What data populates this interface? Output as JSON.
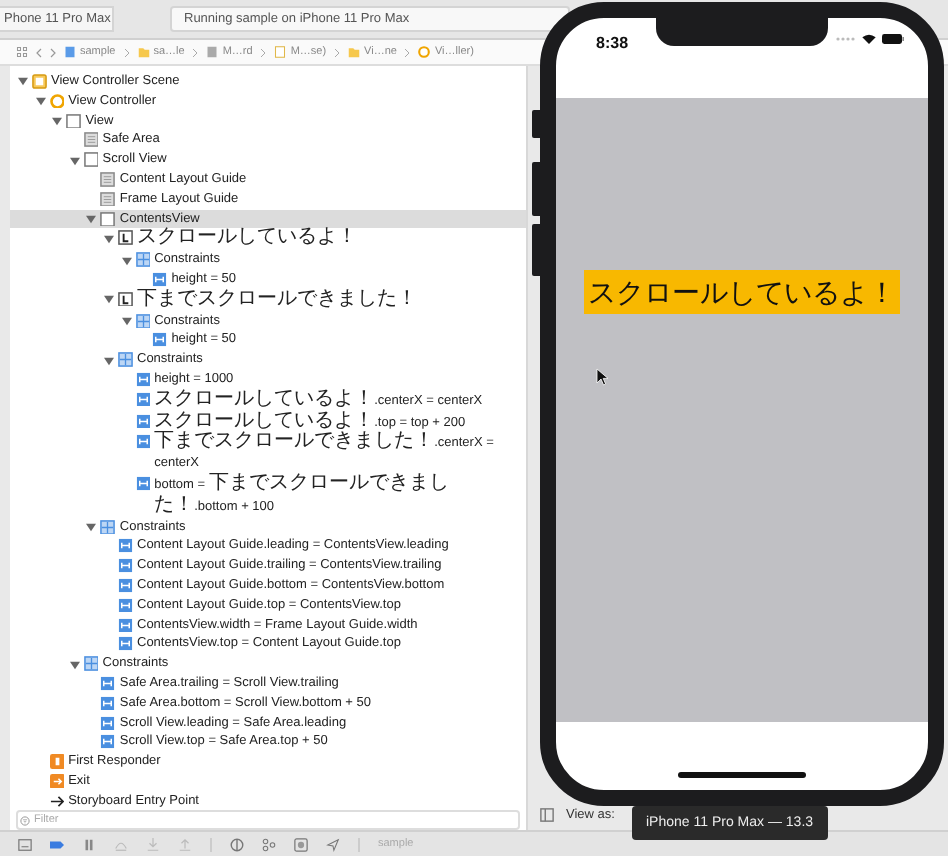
{
  "toolbar": {
    "device": "Phone 11 Pro Max",
    "status": "Running sample on iPhone 11 Pro Max"
  },
  "jump_bar": {
    "crumbs": [
      {
        "kind": "project",
        "label": "sample"
      },
      {
        "kind": "folder",
        "label": "sa…le"
      },
      {
        "kind": "storyboard",
        "label": "M…rd"
      },
      {
        "kind": "file",
        "label": "M…se)"
      },
      {
        "kind": "folder",
        "label": "Vi…ne"
      },
      {
        "kind": "controller",
        "label": "Vi…ller)"
      }
    ]
  },
  "outline": {
    "items": [
      {
        "kind": "scene",
        "label": "View Controller Scene",
        "expanded": true,
        "selected": false,
        "children": [
          {
            "kind": "controller",
            "label": "View Controller",
            "expanded": true,
            "selected": false,
            "children": [
              {
                "kind": "view",
                "label": "View",
                "expanded": true,
                "selected": false,
                "children": [
                  {
                    "kind": "guide",
                    "label": "Safe Area",
                    "selected": false
                  },
                  {
                    "kind": "view",
                    "label": "Scroll View",
                    "expanded": true,
                    "selected": false,
                    "children": [
                      {
                        "kind": "guide",
                        "label": "Content Layout Guide",
                        "selected": false
                      },
                      {
                        "kind": "guide",
                        "label": "Frame Layout Guide",
                        "selected": false
                      },
                      {
                        "kind": "view",
                        "label": "ContentsView",
                        "expanded": true,
                        "selected": true,
                        "children": [
                          {
                            "kind": "label",
                            "label": "スクロールしているよ！",
                            "expanded": true,
                            "selected": false,
                            "children": [
                              {
                                "kind": "constraints",
                                "label": "Constraints",
                                "expanded": true,
                                "selected": false,
                                "children": [
                                  {
                                    "kind": "constraint",
                                    "label": "height = 50",
                                    "selected": false
                                  }
                                ]
                              }
                            ]
                          },
                          {
                            "kind": "label",
                            "label": "下までスクロールできました！",
                            "expanded": true,
                            "selected": false,
                            "children": [
                              {
                                "kind": "constraints",
                                "label": "Constraints",
                                "expanded": true,
                                "selected": false,
                                "children": [
                                  {
                                    "kind": "constraint",
                                    "label": "height = 50",
                                    "selected": false
                                  }
                                ]
                              }
                            ]
                          },
                          {
                            "kind": "constraints",
                            "label": "Constraints",
                            "expanded": true,
                            "selected": false,
                            "children": [
                              {
                                "kind": "constraint",
                                "label": "height = 1000",
                                "selected": false
                              },
                              {
                                "kind": "constraint",
                                "label": "スクロールしているよ！.centerX = centerX",
                                "selected": false
                              },
                              {
                                "kind": "constraint",
                                "label": "スクロールしているよ！.top = top + 200",
                                "selected": false
                              },
                              {
                                "kind": "constraint",
                                "label": "下までスクロールできました！.centerX = centerX",
                                "selected": false
                              },
                              {
                                "kind": "constraint",
                                "label": "bottom = 下までスクロールできました！.bottom + 100",
                                "selected": false
                              }
                            ]
                          }
                        ]
                      },
                      {
                        "kind": "constraints",
                        "label": "Constraints",
                        "expanded": true,
                        "selected": false,
                        "children": [
                          {
                            "kind": "constraint",
                            "label": "Content Layout Guide.leading = ContentsView.leading",
                            "selected": false
                          },
                          {
                            "kind": "constraint",
                            "label": "Content Layout Guide.trailing = ContentsView.trailing",
                            "selected": false
                          },
                          {
                            "kind": "constraint",
                            "label": "Content Layout Guide.bottom = ContentsView.bottom",
                            "selected": false
                          },
                          {
                            "kind": "constraint",
                            "label": "Content Layout Guide.top = ContentsView.top",
                            "selected": false
                          },
                          {
                            "kind": "constraint",
                            "label": "ContentsView.width = Frame Layout Guide.width",
                            "selected": false
                          },
                          {
                            "kind": "constraint",
                            "label": "ContentsView.top = Content Layout Guide.top",
                            "selected": false
                          }
                        ]
                      }
                    ]
                  },
                  {
                    "kind": "constraints",
                    "label": "Constraints",
                    "expanded": true,
                    "selected": false,
                    "children": [
                      {
                        "kind": "constraint",
                        "label": "Safe Area.trailing = Scroll View.trailing",
                        "selected": false
                      },
                      {
                        "kind": "constraint",
                        "label": "Safe Area.bottom = Scroll View.bottom + 50",
                        "selected": false
                      },
                      {
                        "kind": "constraint",
                        "label": "Scroll View.leading = Safe Area.leading",
                        "selected": false
                      },
                      {
                        "kind": "constraint",
                        "label": "Scroll View.top = Safe Area.top + 50",
                        "selected": false
                      }
                    ]
                  }
                ]
              }
            ]
          },
          {
            "kind": "responder",
            "label": "First Responder",
            "selected": false
          },
          {
            "kind": "exit",
            "label": "Exit",
            "selected": false
          },
          {
            "kind": "entry",
            "label": "Storyboard Entry Point",
            "selected": false
          }
        ]
      }
    ]
  },
  "filter": {
    "placeholder": "Filter"
  },
  "canvas": {
    "view_as": "View as:"
  },
  "debug_bar": {
    "target": "sample"
  },
  "simulator": {
    "time": "8:38",
    "label": "スクロールしているよ！"
  },
  "tooltip": "iPhone 11 Pro Max — 13.3"
}
